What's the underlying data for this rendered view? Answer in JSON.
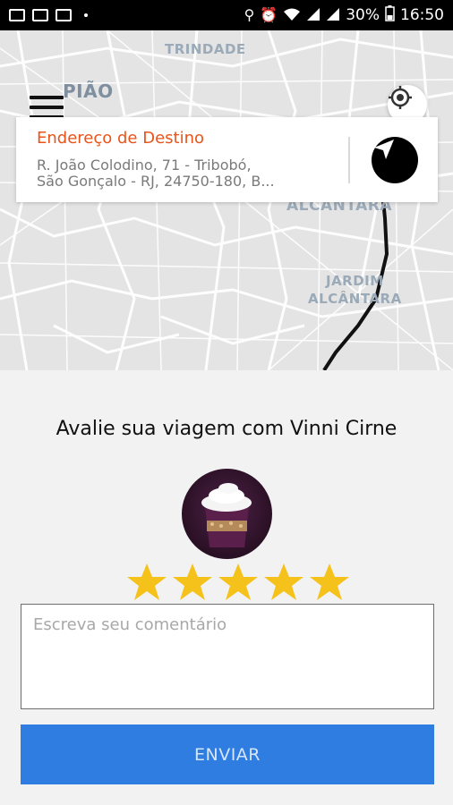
{
  "status_bar": {
    "battery": "30%",
    "time": "16:50",
    "icons": [
      "gallery-icon",
      "cast-icon",
      "cast-icon",
      "dot-icon",
      "location-icon",
      "alarm-icon",
      "wifi-icon",
      "signal-icon",
      "signal-icon",
      "battery-icon"
    ]
  },
  "map": {
    "labels": {
      "trindade": "TRINDADE",
      "piao": "PIÃO",
      "alcantara": "ALCANTARA",
      "jardim": "JARDIM",
      "jardim_alcantara": "ALCÂNTARA"
    }
  },
  "destination": {
    "title": "Endereço de Destino",
    "address": "R. João Colodino, 71 - Tribobó,\nSão Gonçalo - RJ, 24750-180, B..."
  },
  "rating": {
    "title": "Avalie sua viagem com Vinni Cirne",
    "stars": 5,
    "max_stars": 5,
    "comment_placeholder": "Escreva seu comentário",
    "comment_value": "",
    "send_label": "ENVIAR"
  },
  "colors": {
    "accent_orange": "#e8541a",
    "button_blue": "#2f7de1",
    "star_yellow": "#f5c21b"
  }
}
